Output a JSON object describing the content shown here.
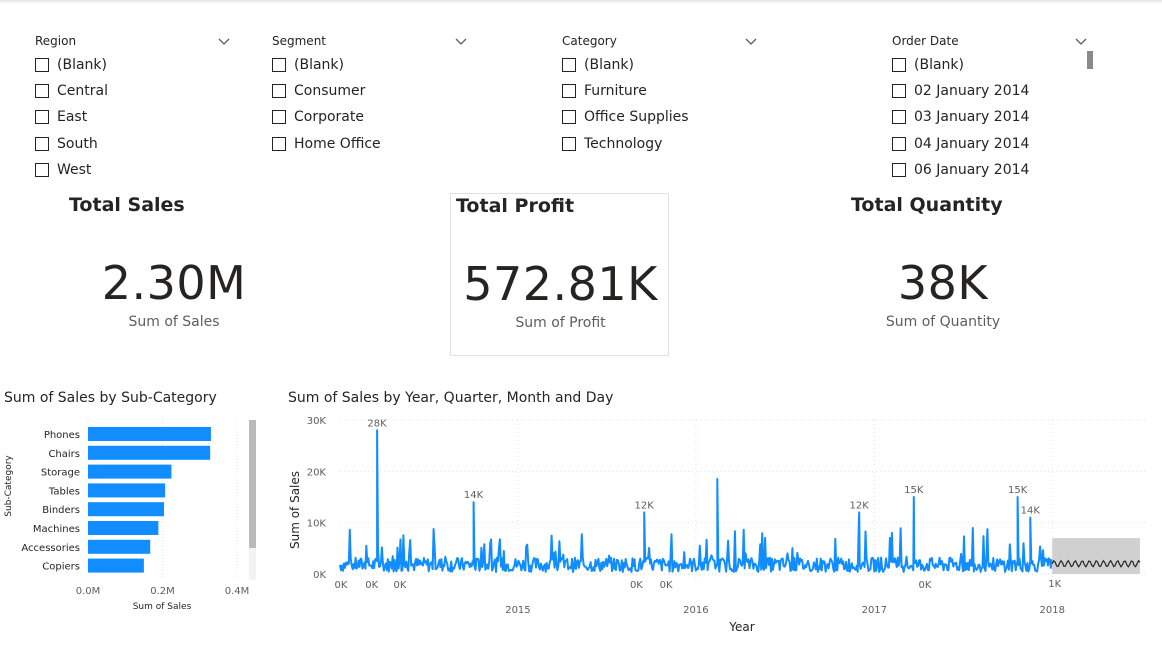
{
  "slicers": [
    {
      "title": "Region",
      "options": [
        "(Blank)",
        "Central",
        "East",
        "South",
        "West"
      ]
    },
    {
      "title": "Segment",
      "options": [
        "(Blank)",
        "Consumer",
        "Corporate",
        "Home Office"
      ]
    },
    {
      "title": "Category",
      "options": [
        "(Blank)",
        "Furniture",
        "Office Supplies",
        "Technology"
      ]
    },
    {
      "title": "Order Date",
      "options": [
        "(Blank)",
        "02 January 2014",
        "03 January 2014",
        "04 January 2014",
        "06 January 2014"
      ]
    }
  ],
  "cards": [
    {
      "title": "Total Sales",
      "value": "2.30M",
      "label": "Sum of Sales"
    },
    {
      "title": "Total Profit",
      "value": "572.81K",
      "label": "Sum of Profit"
    },
    {
      "title": "Total Quantity",
      "value": "38K",
      "label": "Sum of Quantity"
    }
  ],
  "colors": {
    "bar": "#118DFF",
    "forecast": "#252423",
    "band": "#c8c8c8"
  },
  "chart_data": [
    {
      "type": "bar",
      "orientation": "horizontal",
      "title": "Sum of Sales by Sub-Category",
      "xlabel": "Sum of Sales",
      "ylabel": "Sub-Category",
      "categories": [
        "Phones",
        "Chairs",
        "Storage",
        "Tables",
        "Binders",
        "Machines",
        "Accessories",
        "Copiers"
      ],
      "values": [
        330000,
        328000,
        224000,
        207000,
        204000,
        189000,
        167000,
        150000
      ],
      "xlim": [
        0,
        400000
      ],
      "xticks": [
        "0.0M",
        "0.2M",
        "0.4M"
      ],
      "grid": true
    },
    {
      "type": "line",
      "title": "Sum of Sales by Year, Quarter, Month and Day",
      "xlabel": "Year",
      "ylabel": "Sum of Sales",
      "xlim": [
        "2014-01-01",
        "2018-06-30"
      ],
      "ylim": [
        0,
        30000
      ],
      "yticks": [
        "0K",
        "10K",
        "20K",
        "30K"
      ],
      "xticks": [
        {
          "label": "2015",
          "date": "2015-01-01"
        },
        {
          "label": "2016",
          "date": "2016-01-01"
        },
        {
          "label": "2017",
          "date": "2017-01-01"
        },
        {
          "label": "2018",
          "date": "2018-01-01"
        }
      ],
      "series": [
        {
          "kind": "actual",
          "baseline": 2000,
          "range": [
            "2014-01-01",
            "2017-12-31"
          ],
          "peaks": [
            {
              "date": "2014-03-18",
              "value": 28000
            },
            {
              "date": "2014-10-02",
              "value": 14000
            },
            {
              "date": "2015-09-17",
              "value": 12000
            },
            {
              "date": "2016-02-14",
              "value": 18500
            },
            {
              "date": "2016-12-01",
              "value": 12000
            },
            {
              "date": "2017-03-23",
              "value": 15000
            },
            {
              "date": "2017-10-22",
              "value": 15000
            },
            {
              "date": "2017-11-17",
              "value": 11000
            }
          ]
        },
        {
          "kind": "forecast",
          "value": 2000,
          "band": [
            0,
            7000
          ],
          "range": [
            "2018-01-01",
            "2018-06-30"
          ]
        }
      ],
      "data_labels": [
        {
          "text": "28K",
          "date": "2014-03-18",
          "value": 28000
        },
        {
          "text": "14K",
          "date": "2014-10-02",
          "value": 14000
        },
        {
          "text": "12K",
          "date": "2015-09-17",
          "value": 12000
        },
        {
          "text": "12K",
          "date": "2016-12-01",
          "value": 12000
        },
        {
          "text": "15K",
          "date": "2017-03-23",
          "value": 15000
        },
        {
          "text": "15K",
          "date": "2017-10-22",
          "value": 15000
        },
        {
          "text": "14K",
          "date": "2017-11-17",
          "value": 11000
        },
        {
          "text": "0K",
          "date": "2014-01-03",
          "value": 0
        },
        {
          "text": "0K",
          "date": "2014-03-07",
          "value": 0
        },
        {
          "text": "0K",
          "date": "2014-05-04",
          "value": 0
        },
        {
          "text": "0K",
          "date": "2015-09-01",
          "value": 0
        },
        {
          "text": "0K",
          "date": "2015-11-01",
          "value": 0
        },
        {
          "text": "0K",
          "date": "2017-04-15",
          "value": 0
        },
        {
          "text": "1K",
          "date": "2018-01-06",
          "value": 1000
        }
      ]
    }
  ]
}
